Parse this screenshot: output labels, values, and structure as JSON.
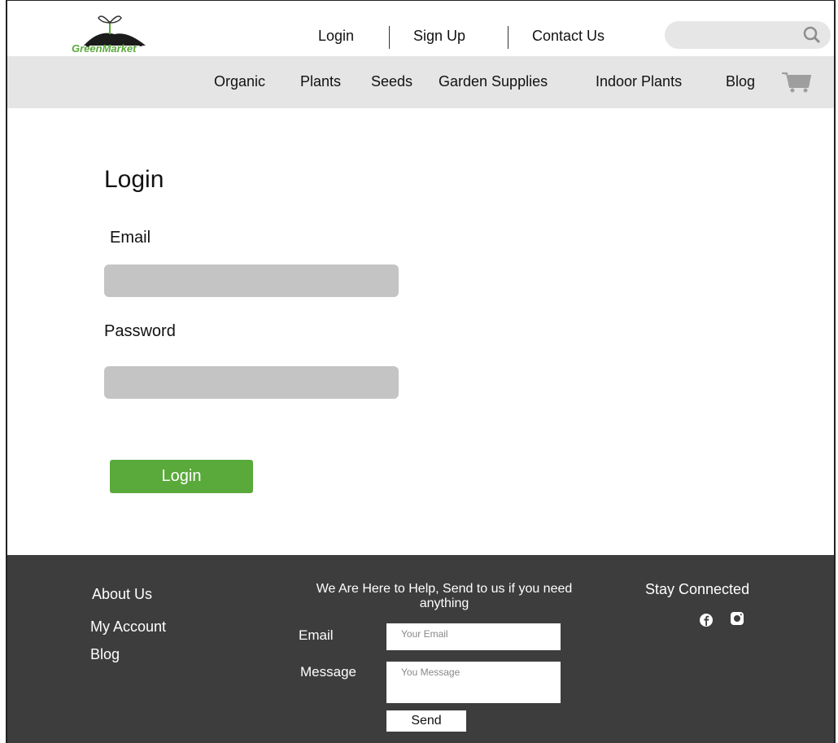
{
  "brand": {
    "name": "GreenMarket",
    "accent": "#5aa93b"
  },
  "top_links": {
    "login": "Login",
    "signup": "Sign Up",
    "contact": "Contact Us"
  },
  "search": {
    "placeholder": "",
    "icon": "search-icon"
  },
  "nav": {
    "organic": "Organic",
    "plants": "Plants",
    "seeds": "Seeds",
    "garden_supplies": "Garden Supplies",
    "indoor_plants": "Indoor Plants",
    "blog": "Blog",
    "cart_icon": "cart-icon"
  },
  "main": {
    "title": "Login",
    "email_label": "Email",
    "email_value": "",
    "password_label": "Password",
    "password_value": "",
    "login_button": "Login"
  },
  "footer": {
    "about": "About Us",
    "account": "My Account",
    "blog": "Blog",
    "help_text": "We Are Here to Help, Send to us if you need anything",
    "email_label": "Email",
    "email_placeholder": "Your Email",
    "message_label": "Message",
    "message_placeholder": "You Message",
    "send_button": "Send",
    "stay_connected": "Stay Connected",
    "social_icons": [
      "facebook-icon",
      "instagram-icon"
    ]
  },
  "colors": {
    "nav_bg": "#e5e5e5",
    "footer_bg": "#3d3d3d",
    "input_bg": "#c4c4c4",
    "button": "#5aa93b"
  }
}
